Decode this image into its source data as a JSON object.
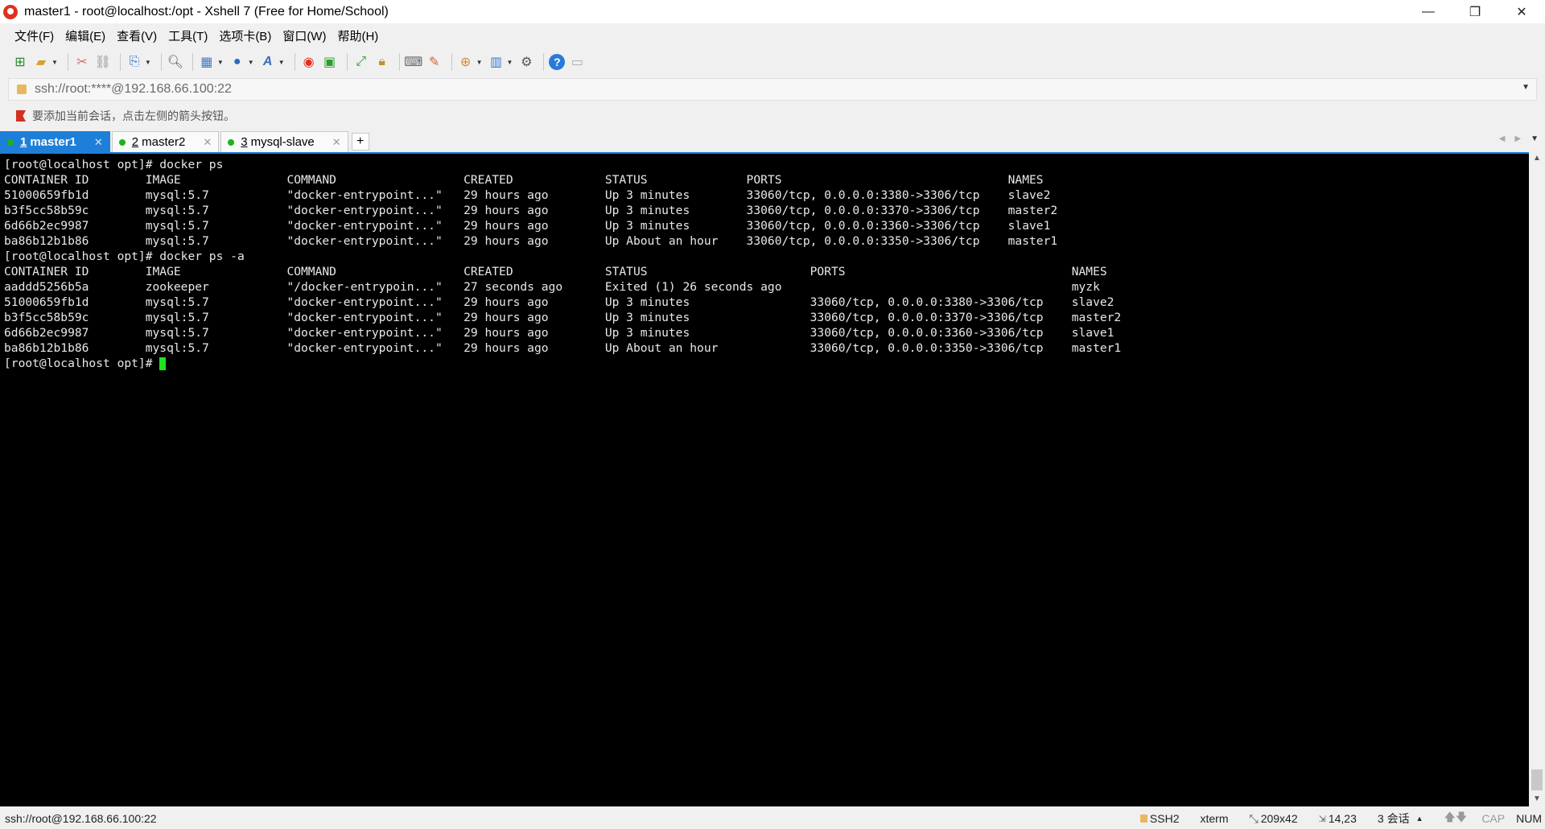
{
  "window": {
    "title": "master1 - root@localhost:/opt - Xshell 7 (Free for Home/School)",
    "controls": [
      "—",
      "❐",
      "✕"
    ]
  },
  "menu": [
    "文件(F)",
    "编辑(E)",
    "查看(V)",
    "工具(T)",
    "选项卡(B)",
    "窗口(W)",
    "帮助(H)"
  ],
  "address": {
    "value": "ssh://root:****@192.168.66.100:22"
  },
  "hint": "要添加当前会话，点击左侧的箭头按钮。",
  "tabs": [
    {
      "num": "1",
      "label": "master1"
    },
    {
      "num": "2",
      "label": "master2"
    },
    {
      "num": "3",
      "label": "mysql-slave"
    }
  ],
  "terminal": {
    "lines": [
      "[root@localhost opt]# docker ps",
      "CONTAINER ID        IMAGE               COMMAND                  CREATED             STATUS              PORTS                                NAMES",
      "51000659fb1d        mysql:5.7           \"docker-entrypoint...\"   29 hours ago        Up 3 minutes        33060/tcp, 0.0.0.0:3380->3306/tcp    slave2",
      "b3f5cc58b59c        mysql:5.7           \"docker-entrypoint...\"   29 hours ago        Up 3 minutes        33060/tcp, 0.0.0.0:3370->3306/tcp    master2",
      "6d66b2ec9987        mysql:5.7           \"docker-entrypoint...\"   29 hours ago        Up 3 minutes        33060/tcp, 0.0.0.0:3360->3306/tcp    slave1",
      "ba86b12b1b86        mysql:5.7           \"docker-entrypoint...\"   29 hours ago        Up About an hour    33060/tcp, 0.0.0.0:3350->3306/tcp    master1",
      "[root@localhost opt]# docker ps -a",
      "CONTAINER ID        IMAGE               COMMAND                  CREATED             STATUS                       PORTS                                NAMES",
      "aaddd5256b5a        zookeeper           \"/docker-entrypoin...\"   27 seconds ago      Exited (1) 26 seconds ago                                         myzk",
      "51000659fb1d        mysql:5.7           \"docker-entrypoint...\"   29 hours ago        Up 3 minutes                 33060/tcp, 0.0.0.0:3380->3306/tcp    slave2",
      "b3f5cc58b59c        mysql:5.7           \"docker-entrypoint...\"   29 hours ago        Up 3 minutes                 33060/tcp, 0.0.0.0:3370->3306/tcp    master2",
      "6d66b2ec9987        mysql:5.7           \"docker-entrypoint...\"   29 hours ago        Up 3 minutes                 33060/tcp, 0.0.0.0:3360->3306/tcp    slave1",
      "ba86b12b1b86        mysql:5.7           \"docker-entrypoint...\"   29 hours ago        Up About an hour             33060/tcp, 0.0.0.0:3350->3306/tcp    master1"
    ],
    "prompt": "[root@localhost opt]# "
  },
  "status": {
    "connection": "ssh://root@192.168.66.100:22",
    "protocol": "SSH2",
    "term": "xterm",
    "size": "209x42",
    "pos": "14,23",
    "sessions": "3 会话",
    "cap": "CAP",
    "num": "NUM"
  }
}
